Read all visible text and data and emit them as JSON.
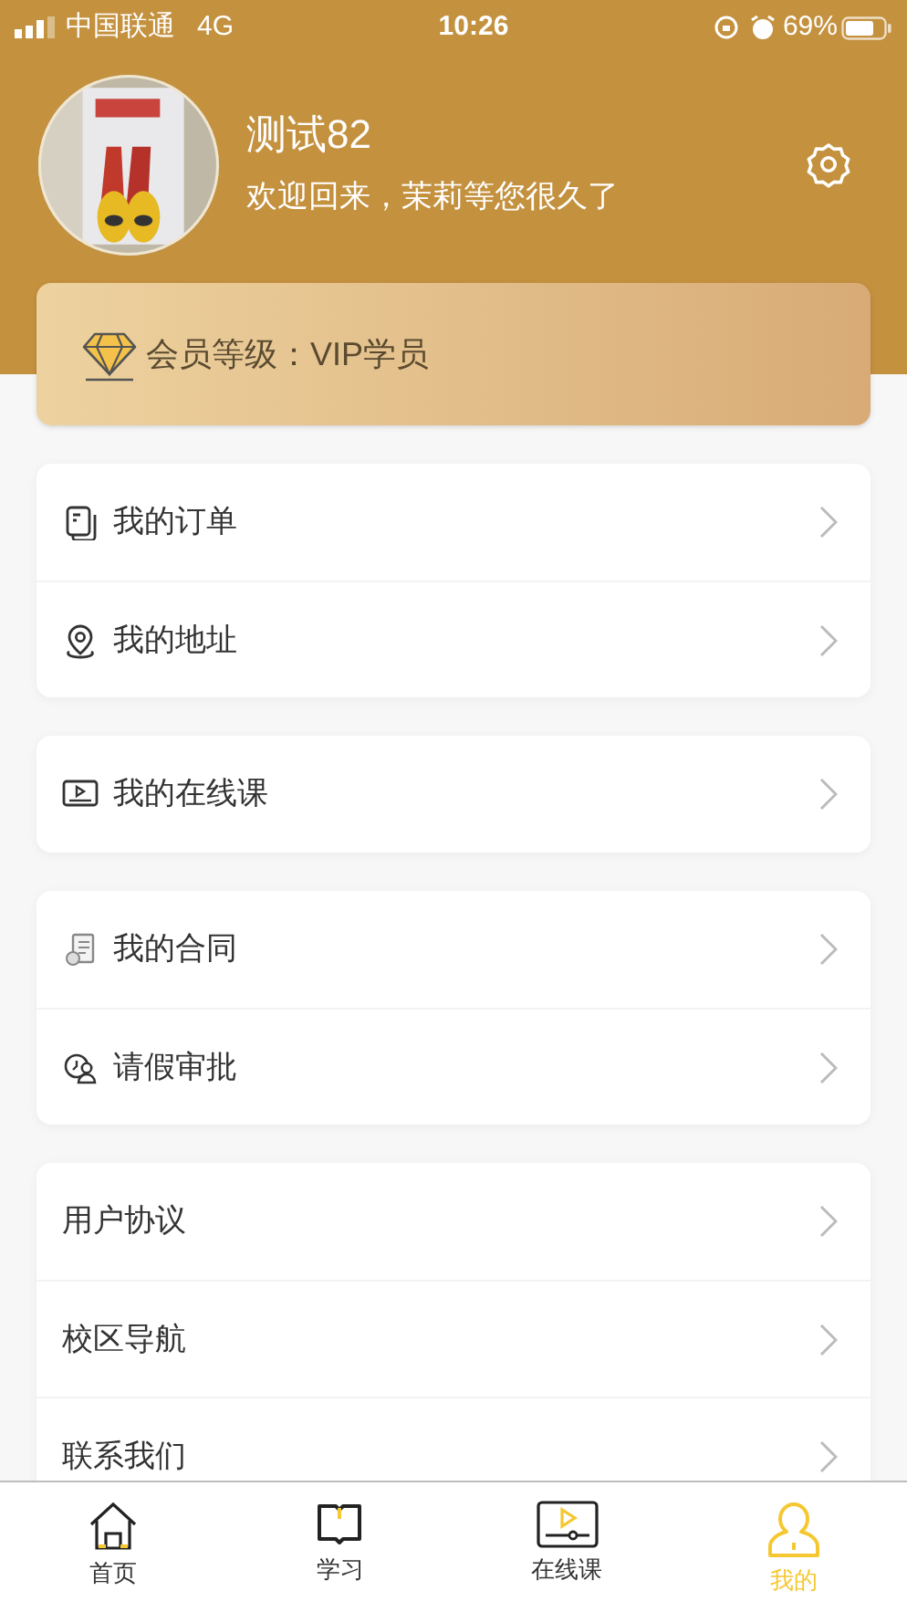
{
  "status_bar": {
    "carrier": "中国联通",
    "network": "4G",
    "time": "10:26",
    "battery": "69%"
  },
  "profile": {
    "name": "测试82",
    "greeting": "欢迎回来，茉莉等您很久了"
  },
  "membership": {
    "label": "会员等级：VIP学员"
  },
  "menu_groups": [
    {
      "items": [
        {
          "kind": "icon",
          "label": "我的订单"
        },
        {
          "kind": "icon",
          "label": "我的地址"
        }
      ]
    },
    {
      "items": [
        {
          "kind": "icon",
          "label": "我的在线课"
        }
      ]
    },
    {
      "items": [
        {
          "kind": "icon",
          "label": "我的合同"
        },
        {
          "kind": "icon",
          "label": "请假审批"
        }
      ]
    },
    {
      "items": [
        {
          "kind": "plain",
          "label": "用户协议"
        },
        {
          "kind": "plain",
          "label": "校区导航"
        },
        {
          "kind": "plain",
          "label": "联系我们"
        }
      ]
    }
  ],
  "tab_bar": [
    {
      "label": "首页",
      "selected": false
    },
    {
      "label": "学习",
      "selected": false
    },
    {
      "label": "在线课",
      "selected": false
    },
    {
      "label": "我的",
      "selected": true
    }
  ]
}
